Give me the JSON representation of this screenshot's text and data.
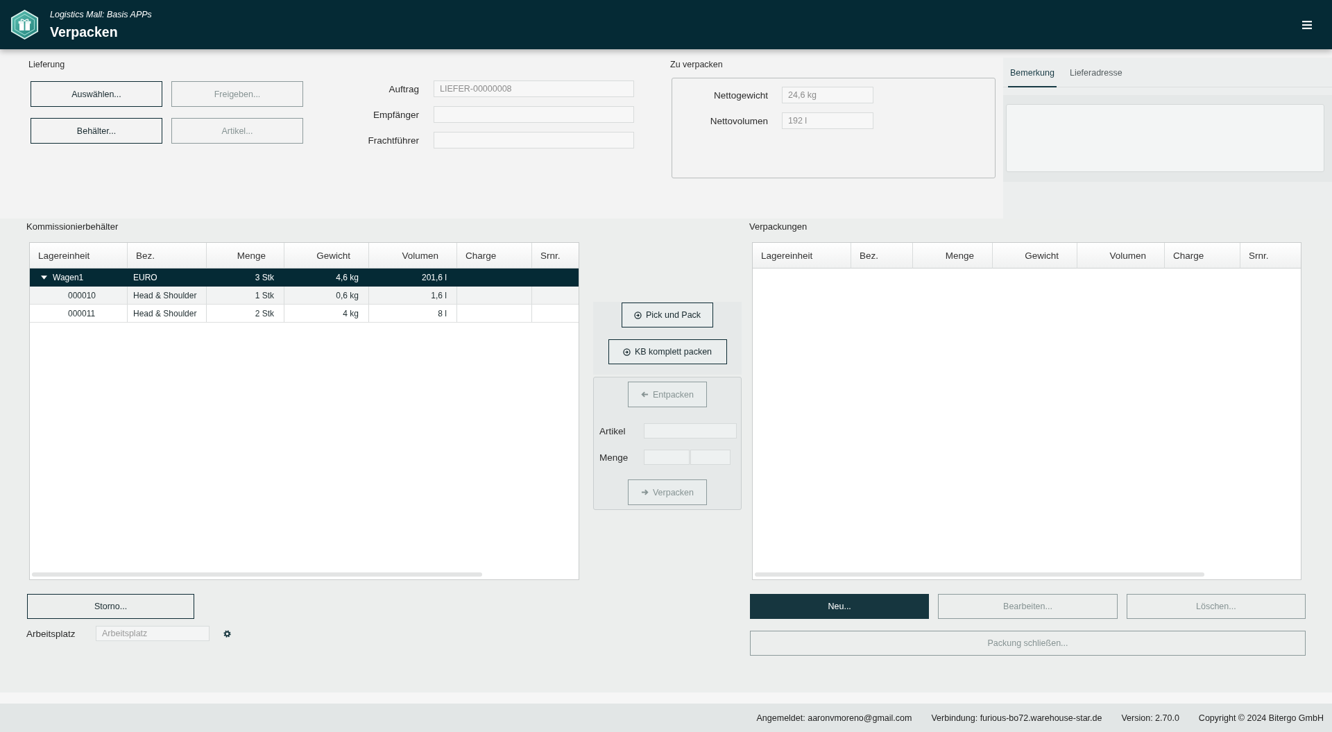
{
  "header": {
    "subtitle": "Logistics Mall: Basis APPs",
    "title": "Verpacken"
  },
  "lieferung": {
    "title": "Lieferung",
    "buttons": [
      {
        "label": "Auswählen...",
        "disabled": false
      },
      {
        "label": "Freigeben...",
        "disabled": true
      },
      {
        "label": "Behälter...",
        "disabled": false
      },
      {
        "label": "Artikel...",
        "disabled": true
      }
    ],
    "fields": [
      {
        "label": "Auftrag",
        "value": "LIEFER-00000008"
      },
      {
        "label": "Empfänger"
      },
      {
        "label": "Frachtführer"
      }
    ]
  },
  "zu_verpacken": {
    "title": "Zu verpacken",
    "fields": [
      {
        "label": "Nettogewicht",
        "value": "24,6 kg"
      },
      {
        "label": "Nettovolumen",
        "value": "192 l"
      }
    ]
  },
  "detail_tabs": [
    {
      "label": "Bemerkung",
      "selected": true
    },
    {
      "label": "Lieferadresse",
      "selected": false
    }
  ],
  "kommissionierbehaelter": {
    "title": "Kommissionierbehälter",
    "columns": [
      {
        "label": "Lagereinheit",
        "kind": "text"
      },
      {
        "label": "Bez.",
        "kind": "text"
      },
      {
        "label": "Menge",
        "kind": "number"
      },
      {
        "label": "Gewicht",
        "kind": "number"
      },
      {
        "label": "Volumen",
        "kind": "number"
      },
      {
        "label": "Charge",
        "kind": "text"
      },
      {
        "label": "Srnr.",
        "kind": "text"
      }
    ],
    "rows": [
      {
        "cells": [
          "Wagen1",
          "EURO",
          "3 Stk",
          "4,6 kg",
          "201,6 l"
        ],
        "selected": true,
        "expanded": true,
        "children": [
          {
            "cells": [
              "000010",
              "Head & Shoulder",
              "1 Stk",
              "0,6 kg",
              "1,6 l"
            ],
            "selected": false
          },
          {
            "cells": [
              "000011",
              "Head & Shoulder",
              "2 Stk",
              "4 kg",
              "8 l"
            ],
            "selected": false
          }
        ]
      }
    ]
  },
  "transfer": {
    "pack_buttons": [
      {
        "label": "Pick und Pack",
        "disabled": false
      },
      {
        "label": "KB komplett packen",
        "disabled": false
      }
    ],
    "unpack_button": {
      "label": "Entpacken",
      "disabled": true
    },
    "fields": [
      {
        "label": "Artikel",
        "kind": "single"
      },
      {
        "label": "Menge",
        "kind": "pair"
      }
    ],
    "pack_button": {
      "label": "Verpacken",
      "disabled": true
    }
  },
  "storno_button": {
    "label": "Storno...",
    "disabled": false
  },
  "arbeitsplatz": {
    "label": "Arbeitsplatz",
    "placeholder": "Arbeitsplatz"
  },
  "verpackungen": {
    "title": "Verpackungen",
    "columns": [
      {
        "label": "Lagereinheit",
        "kind": "text"
      },
      {
        "label": "Bez.",
        "kind": "text"
      },
      {
        "label": "Menge",
        "kind": "number"
      },
      {
        "label": "Gewicht",
        "kind": "number"
      },
      {
        "label": "Volumen",
        "kind": "number"
      },
      {
        "label": "Charge",
        "kind": "text"
      },
      {
        "label": "Srnr.",
        "kind": "text"
      }
    ]
  },
  "package_actions": [
    {
      "label": "Neu...",
      "primary": true,
      "disabled": false
    },
    {
      "label": "Bearbeiten...",
      "primary": false,
      "disabled": true
    },
    {
      "label": "Löschen...",
      "primary": false,
      "disabled": true
    }
  ],
  "close_package_button": {
    "label": "Packung schließen...",
    "disabled": true
  },
  "status_bar": {
    "items": [
      "Angemeldet: aaronvmoreno@gmail.com",
      "Verbindung: furious-bo72.warehouse-star.de",
      "Version: 2.70.0",
      "Copyright © 2024 Bitergo GmbH"
    ]
  }
}
